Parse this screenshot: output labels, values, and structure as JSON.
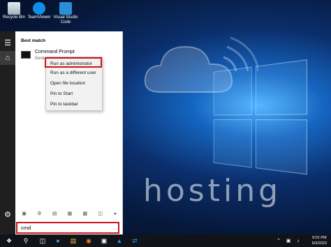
{
  "desktop": {
    "icons": [
      {
        "label": "Recycle Bin",
        "icon": "recycle-bin-icon",
        "color": "#cfd8dc"
      },
      {
        "label": "TeamViewer",
        "icon": "teamviewer-icon",
        "color": "#0e8ee9"
      },
      {
        "label": "Visual Studio Code",
        "icon": "vscode-icon",
        "color": "#2a8fd8"
      }
    ],
    "watermark": "hosting"
  },
  "start_menu": {
    "section_title": "Best match",
    "result": {
      "title": "Command Prompt",
      "subtitle": "Desk"
    },
    "context_menu": [
      "Run as administrator",
      "Run as a different user",
      "Open file location",
      "Pin to Start",
      "Pin to taskbar"
    ],
    "search_value": "cmd"
  },
  "taskbar": {
    "time": "9:01 PM",
    "date": "5/3/2023"
  },
  "colors": {
    "highlight_border": "#d0111a",
    "taskbar_bg": "#101418",
    "rail_bg": "#1f1f1f"
  }
}
